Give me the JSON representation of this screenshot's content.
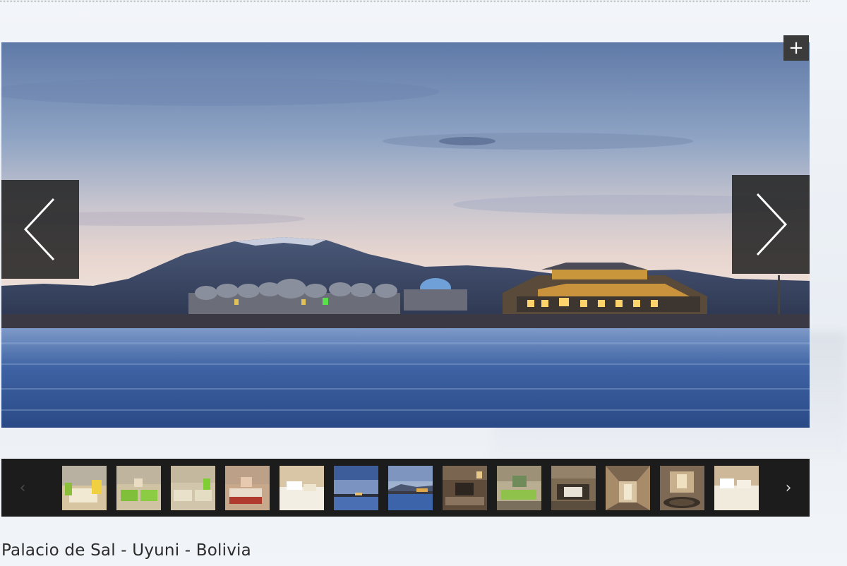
{
  "gallery": {
    "expand_label": "+",
    "prev_icon": "chevron-left-icon",
    "next_icon": "chevron-right-icon",
    "main_image": "salt-flat-hotel-dusk-photo",
    "thumbnails": [
      {
        "name": "room-yellow-bed-photo"
      },
      {
        "name": "room-green-beds-photo"
      },
      {
        "name": "room-twin-beds-photo"
      },
      {
        "name": "room-red-bed-photo"
      },
      {
        "name": "bed-towels-photo"
      },
      {
        "name": "salt-flat-sky-photo"
      },
      {
        "name": "hotel-exterior-photo"
      },
      {
        "name": "lounge-dim-photo"
      },
      {
        "name": "lounge-green-sofa-photo"
      },
      {
        "name": "dining-hall-photo"
      },
      {
        "name": "corridor-photo"
      },
      {
        "name": "lobby-photo"
      },
      {
        "name": "bed-cream-photo"
      }
    ]
  },
  "caption": "Palacio de Sal - Uyuni - Bolivia",
  "colors": {
    "nav_bg": "#1e1e1e",
    "thumb_bar_bg": "#1c1c1c",
    "caption_text": "#2b2b2b"
  }
}
